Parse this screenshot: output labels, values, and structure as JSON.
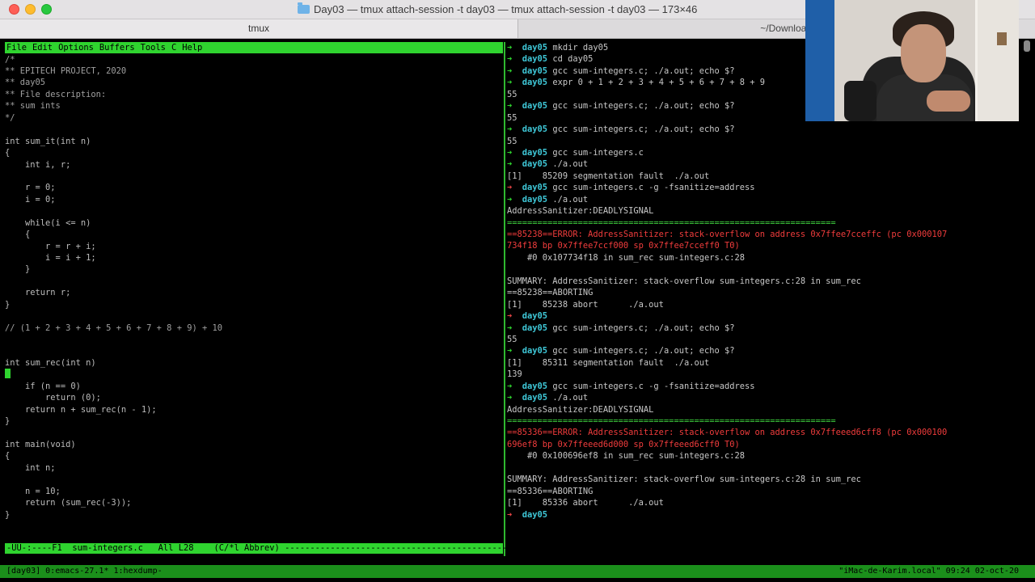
{
  "window": {
    "title": "Day03 — tmux attach-session -t day03 — tmux attach-session -t day03 — 173×46"
  },
  "tabs": [
    {
      "label": "tmux"
    },
    {
      "label": "~/Downloads"
    }
  ],
  "emacs": {
    "menu": [
      "File",
      "Edit",
      "Options",
      "Buffers",
      "Tools",
      "C",
      "Help"
    ],
    "code_lines": [
      "/*",
      "** EPITECH PROJECT, 2020",
      "** day05",
      "** File description:",
      "** sum ints",
      "*/",
      "",
      "int sum_it(int n)",
      "{",
      "    int i, r;",
      "",
      "    r = 0;",
      "    i = 0;",
      "",
      "    while(i <= n)",
      "    {",
      "        r = r + i;",
      "        i = i + 1;",
      "    }",
      "",
      "    return r;",
      "}",
      "",
      "// (1 + 2 + 3 + 4 + 5 + 6 + 7 + 8 + 9) + 10",
      "",
      "",
      "int sum_rec(int n)",
      "{",
      "    if (n == 0)",
      "        return (0);",
      "    return n + sum_rec(n - 1);",
      "}",
      "",
      "int main(void)",
      "{",
      "    int n;",
      "",
      "    n = 10;",
      "    return (sum_rec(-3));",
      "}"
    ],
    "modeline": "-UU-:----F1  sum-integers.c   All L28    (C/*l Abbrev) ------------------------------------------------"
  },
  "shell": {
    "lines": [
      {
        "kind": "prompt",
        "arrow": "g",
        "dir": "day05",
        "cmd": "mkdir day05"
      },
      {
        "kind": "prompt",
        "arrow": "g",
        "dir": "day05",
        "cmd": "cd day05"
      },
      {
        "kind": "prompt",
        "arrow": "g",
        "dir": "day05",
        "cmd": "gcc sum-integers.c; ./a.out; echo $?"
      },
      {
        "kind": "prompt",
        "arrow": "g",
        "dir": "day05",
        "cmd": "expr 0 + 1 + 2 + 3 + 4 + 5 + 6 + 7 + 8 + 9"
      },
      {
        "kind": "out",
        "text": "55"
      },
      {
        "kind": "prompt",
        "arrow": "g",
        "dir": "day05",
        "cmd": "gcc sum-integers.c; ./a.out; echo $?"
      },
      {
        "kind": "out",
        "text": "55"
      },
      {
        "kind": "prompt",
        "arrow": "g",
        "dir": "day05",
        "cmd": "gcc sum-integers.c; ./a.out; echo $?"
      },
      {
        "kind": "out",
        "text": "55"
      },
      {
        "kind": "prompt",
        "arrow": "g",
        "dir": "day05",
        "cmd": "gcc sum-integers.c"
      },
      {
        "kind": "prompt",
        "arrow": "g",
        "dir": "day05",
        "cmd": "./a.out"
      },
      {
        "kind": "out",
        "text": "[1]    85209 segmentation fault  ./a.out"
      },
      {
        "kind": "prompt",
        "arrow": "r",
        "dir": "day05",
        "cmd": "gcc sum-integers.c -g -fsanitize=address"
      },
      {
        "kind": "prompt",
        "arrow": "g",
        "dir": "day05",
        "cmd": "./a.out"
      },
      {
        "kind": "out",
        "text": "AddressSanitizer:DEADLYSIGNAL"
      },
      {
        "kind": "eq",
        "text": "================================================================="
      },
      {
        "kind": "err",
        "text": "==85238==ERROR: AddressSanitizer: stack-overflow on address 0x7ffee7cceffc (pc 0x000107"
      },
      {
        "kind": "err",
        "text": "734f18 bp 0x7ffee7ccf000 sp 0x7ffee7cceff0 T0)"
      },
      {
        "kind": "out",
        "text": "    #0 0x107734f18 in sum_rec sum-integers.c:28"
      },
      {
        "kind": "out",
        "text": ""
      },
      {
        "kind": "out",
        "text": "SUMMARY: AddressSanitizer: stack-overflow sum-integers.c:28 in sum_rec"
      },
      {
        "kind": "out",
        "text": "==85238==ABORTING"
      },
      {
        "kind": "out",
        "text": "[1]    85238 abort      ./a.out"
      },
      {
        "kind": "prompt",
        "arrow": "r",
        "dir": "day05",
        "cmd": ""
      },
      {
        "kind": "prompt",
        "arrow": "g",
        "dir": "day05",
        "cmd": "gcc sum-integers.c; ./a.out; echo $?"
      },
      {
        "kind": "out",
        "text": "55"
      },
      {
        "kind": "prompt",
        "arrow": "g",
        "dir": "day05",
        "cmd": "gcc sum-integers.c; ./a.out; echo $?"
      },
      {
        "kind": "out",
        "text": "[1]    85311 segmentation fault  ./a.out"
      },
      {
        "kind": "out",
        "text": "139"
      },
      {
        "kind": "prompt",
        "arrow": "g",
        "dir": "day05",
        "cmd": "gcc sum-integers.c -g -fsanitize=address"
      },
      {
        "kind": "prompt",
        "arrow": "g",
        "dir": "day05",
        "cmd": "./a.out"
      },
      {
        "kind": "out",
        "text": "AddressSanitizer:DEADLYSIGNAL"
      },
      {
        "kind": "eq",
        "text": "================================================================="
      },
      {
        "kind": "err",
        "text": "==85336==ERROR: AddressSanitizer: stack-overflow on address 0x7ffeeed6cff8 (pc 0x000100"
      },
      {
        "kind": "err",
        "text": "696ef8 bp 0x7ffeeed6d000 sp 0x7ffeeed6cff0 T0)"
      },
      {
        "kind": "out",
        "text": "    #0 0x100696ef8 in sum_rec sum-integers.c:28"
      },
      {
        "kind": "out",
        "text": ""
      },
      {
        "kind": "out",
        "text": "SUMMARY: AddressSanitizer: stack-overflow sum-integers.c:28 in sum_rec"
      },
      {
        "kind": "out",
        "text": "==85336==ABORTING"
      },
      {
        "kind": "out",
        "text": "[1]    85336 abort      ./a.out"
      },
      {
        "kind": "prompt",
        "arrow": "r",
        "dir": "day05",
        "cmd": ""
      }
    ]
  },
  "tmux_status": {
    "left": "[day03] 0:emacs-27.1* 1:hexdump-",
    "right": "\"iMac-de-Karim.local\" 09:24 02-oct-20"
  },
  "colors": {
    "accent_green": "#2fd42f",
    "error_red": "#f03c3c",
    "dir_cyan": "#3fc8d8"
  }
}
